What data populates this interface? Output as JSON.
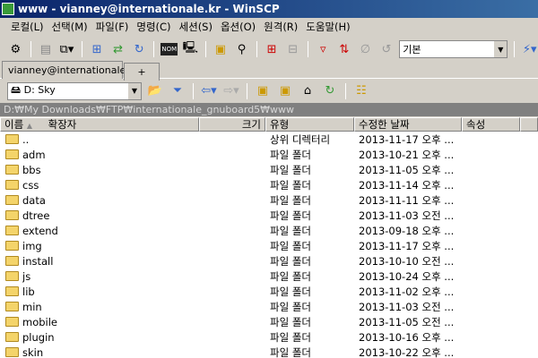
{
  "title": "www - vianney@internationale.kr - WinSCP",
  "menu": [
    "로컬(L)",
    "선택(M)",
    "파일(F)",
    "명령(C)",
    "세션(S)",
    "옵션(O)",
    "원격(R)",
    "도움말(H)"
  ],
  "toolbar": {
    "preset": "기본"
  },
  "tabs": [
    "vianney@internationale.kr",
    "+"
  ],
  "drive": "D: Sky",
  "path": "D:₩My Downloads₩FTP₩internationale_gnuboard5₩www",
  "columns": [
    "이름",
    "확장자",
    "크기",
    "유형",
    "수정한 날짜",
    "속성"
  ],
  "rows": [
    {
      "name": "..",
      "type": "상위 디렉터리",
      "date": "2013-11-17  오후 ..."
    },
    {
      "name": "adm",
      "type": "파일 폴더",
      "date": "2013-10-21  오후 ..."
    },
    {
      "name": "bbs",
      "type": "파일 폴더",
      "date": "2013-11-05  오후 ..."
    },
    {
      "name": "css",
      "type": "파일 폴더",
      "date": "2013-11-14  오후 ..."
    },
    {
      "name": "data",
      "type": "파일 폴더",
      "date": "2013-11-11  오후 ..."
    },
    {
      "name": "dtree",
      "type": "파일 폴더",
      "date": "2013-11-03  오전 ..."
    },
    {
      "name": "extend",
      "type": "파일 폴더",
      "date": "2013-09-18  오후 ..."
    },
    {
      "name": "img",
      "type": "파일 폴더",
      "date": "2013-11-17  오후 ..."
    },
    {
      "name": "install",
      "type": "파일 폴더",
      "date": "2013-10-10  오전 ..."
    },
    {
      "name": "js",
      "type": "파일 폴더",
      "date": "2013-10-24  오후 ..."
    },
    {
      "name": "lib",
      "type": "파일 폴더",
      "date": "2013-11-02  오후 ..."
    },
    {
      "name": "min",
      "type": "파일 폴더",
      "date": "2013-11-03  오전 ..."
    },
    {
      "name": "mobile",
      "type": "파일 폴더",
      "date": "2013-11-05  오전 ..."
    },
    {
      "name": "plugin",
      "type": "파일 폴더",
      "date": "2013-10-16  오후 ..."
    },
    {
      "name": "skin",
      "type": "파일 폴더",
      "date": "2013-10-22  오후 ..."
    }
  ]
}
